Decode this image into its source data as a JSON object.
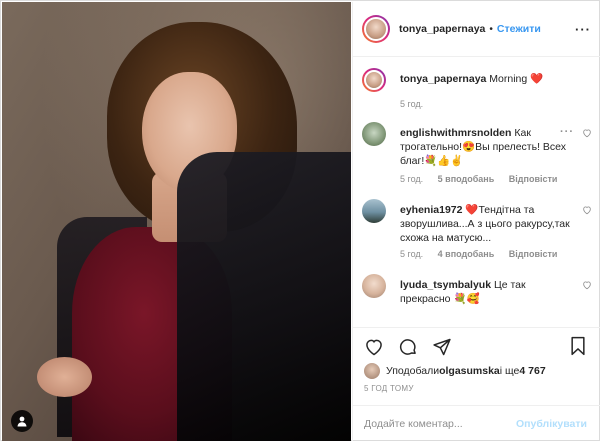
{
  "post": {
    "owner": "tonya_papernaya",
    "separator": "•",
    "follow_label": "Стежити",
    "more_label": "···"
  },
  "caption": {
    "user": "tonya_papernaya",
    "text": "Morning ",
    "emoji": "❤️",
    "time": "5 год."
  },
  "comments": [
    {
      "user": "englishwithmrsnolden",
      "text": "Как трогательно!😍Вы прелесть! Всех благ!💐👍✌️",
      "time": "5 год.",
      "likes": "5 вподобань",
      "reply": "Відповісти",
      "more": "···"
    },
    {
      "user": "eyhenia1972",
      "text": "❤️Тендітна та зворушлива...А з цього ракурсу,так схожа на матусю...",
      "time": "5 год.",
      "likes": "4 вподобань",
      "reply": "Відповісти"
    },
    {
      "user": "lyuda_tsymbalyuk",
      "text": "Це так прекрасно 💐🥰",
      "time": "",
      "likes": "",
      "reply": ""
    }
  ],
  "likes": {
    "prefix": "Уподобали ",
    "user": "olgasumska",
    "middle": " і ще ",
    "count": "4 767"
  },
  "timestamp": "5 ГОД ТОМУ",
  "comment_box": {
    "placeholder": "Додайте коментар...",
    "post_label": "Опублікувати"
  },
  "colors": {
    "link_blue": "#3897f0",
    "post_disabled": "#b2dffc",
    "heart_red": "#ed4956",
    "muted": "#8e8e8e"
  }
}
